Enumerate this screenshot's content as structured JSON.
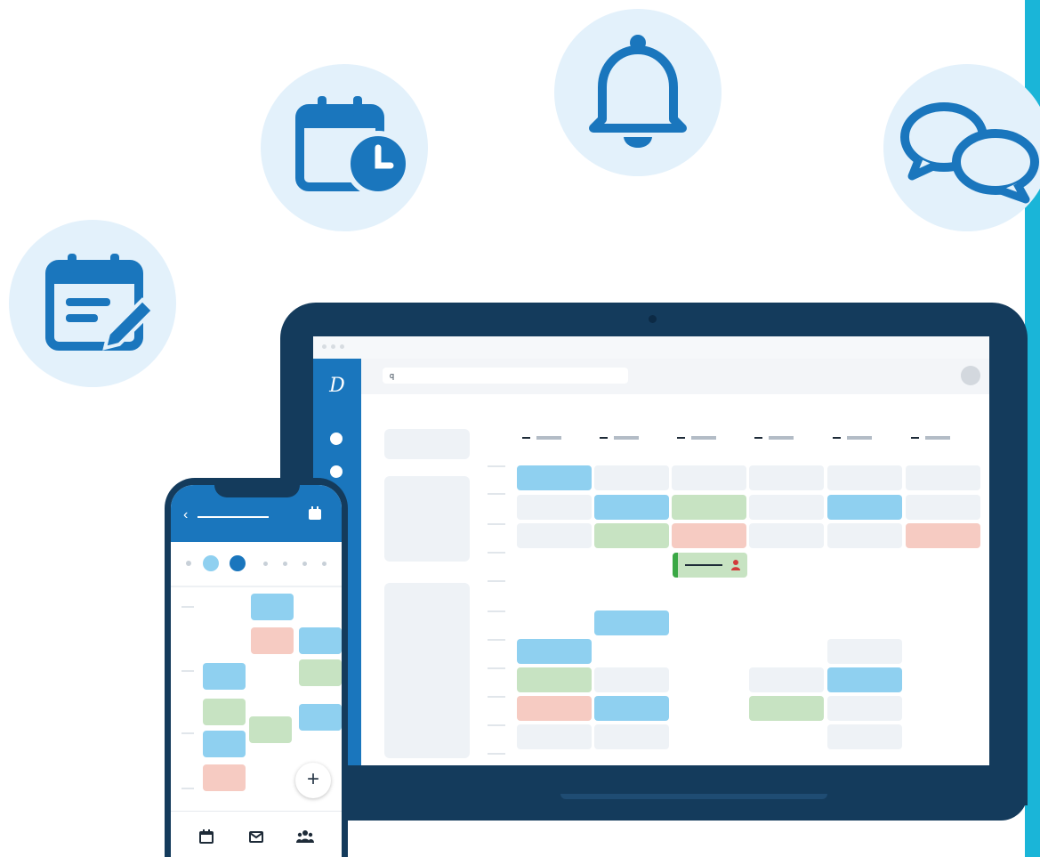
{
  "colors": {
    "brand_blue": "#1a76bd",
    "navy": "#143b5c",
    "bubble_bg": "#e3f1fb",
    "event_blue": "#8fd0f0",
    "event_green": "#c7e3c2",
    "event_red": "#f6cbc2",
    "event_empty": "#eef2f6",
    "edge_cyan": "#1ab5d8"
  },
  "feature_icons": [
    "edit-calendar-icon",
    "calendar-clock-icon",
    "bell-icon",
    "chat-bubbles-icon"
  ],
  "desktop": {
    "search_icon": "q",
    "logo_glyph": "D"
  },
  "phone": {
    "back_glyph": "‹",
    "fab_label": "+",
    "bottom_nav": [
      "calendar-icon",
      "mail-icon",
      "team-icon"
    ]
  }
}
